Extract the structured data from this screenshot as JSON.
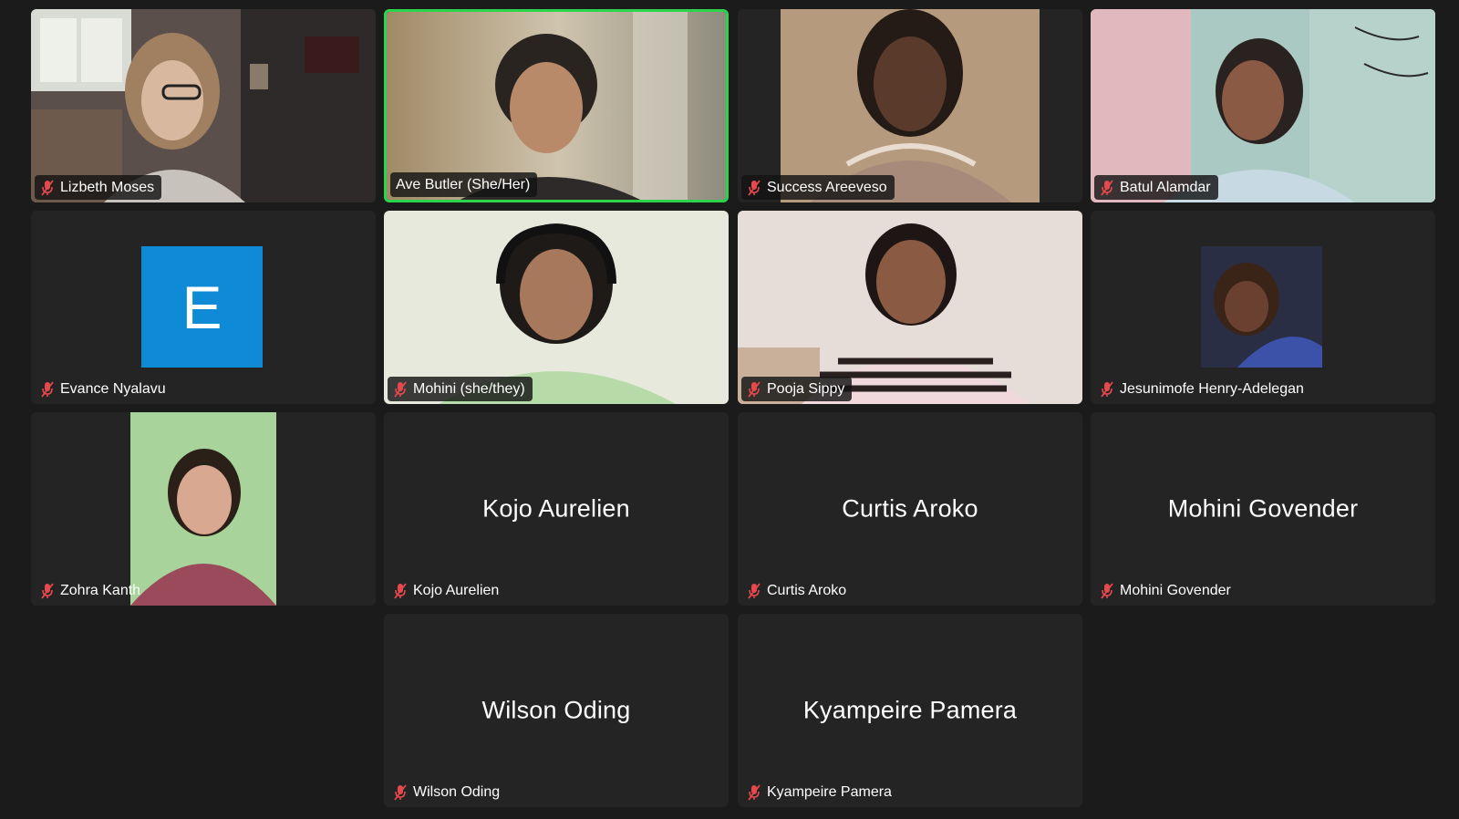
{
  "participants": [
    {
      "name": "Lizbeth Moses",
      "muted": true,
      "video": "on"
    },
    {
      "name": "Ave Butler (She/Her)",
      "muted": false,
      "video": "on",
      "active_speaker": true
    },
    {
      "name": "Success Areeveso",
      "muted": true,
      "video": "on"
    },
    {
      "name": "Batul Alamdar",
      "muted": true,
      "video": "on"
    },
    {
      "name": "Evance Nyalavu",
      "muted": true,
      "video": "off",
      "avatar_initial": "E",
      "avatar_color": "#0e8ad6"
    },
    {
      "name": "Mohini (she/they)",
      "muted": true,
      "video": "on"
    },
    {
      "name": "Pooja Sippy",
      "muted": true,
      "video": "on"
    },
    {
      "name": "Jesunimofe Henry-Adelegan",
      "muted": true,
      "video": "off",
      "avatar": "photo"
    },
    {
      "name": "Zohra Kanth",
      "muted": true,
      "video": "on"
    },
    {
      "name": "Kojo Aurelien",
      "muted": true,
      "video": "off",
      "display_name": "Kojo Aurelien"
    },
    {
      "name": "Curtis Aroko",
      "muted": true,
      "video": "off",
      "display_name": "Curtis Aroko"
    },
    {
      "name": "Mohini Govender",
      "muted": true,
      "video": "off",
      "display_name": "Mohini Govender"
    },
    {
      "name": "Wilson Oding",
      "muted": true,
      "video": "off",
      "display_name": "Wilson Oding"
    },
    {
      "name": "Kyampeire Pamera",
      "muted": true,
      "video": "off",
      "display_name": "Kyampeire Pamera"
    }
  ],
  "icons": {
    "muted": "microphone-muted-icon"
  },
  "colors": {
    "active_speaker_border": "#2bd44a",
    "muted_icon": "#e5484d",
    "tile_bg": "#242424",
    "page_bg": "#1b1b1b"
  }
}
